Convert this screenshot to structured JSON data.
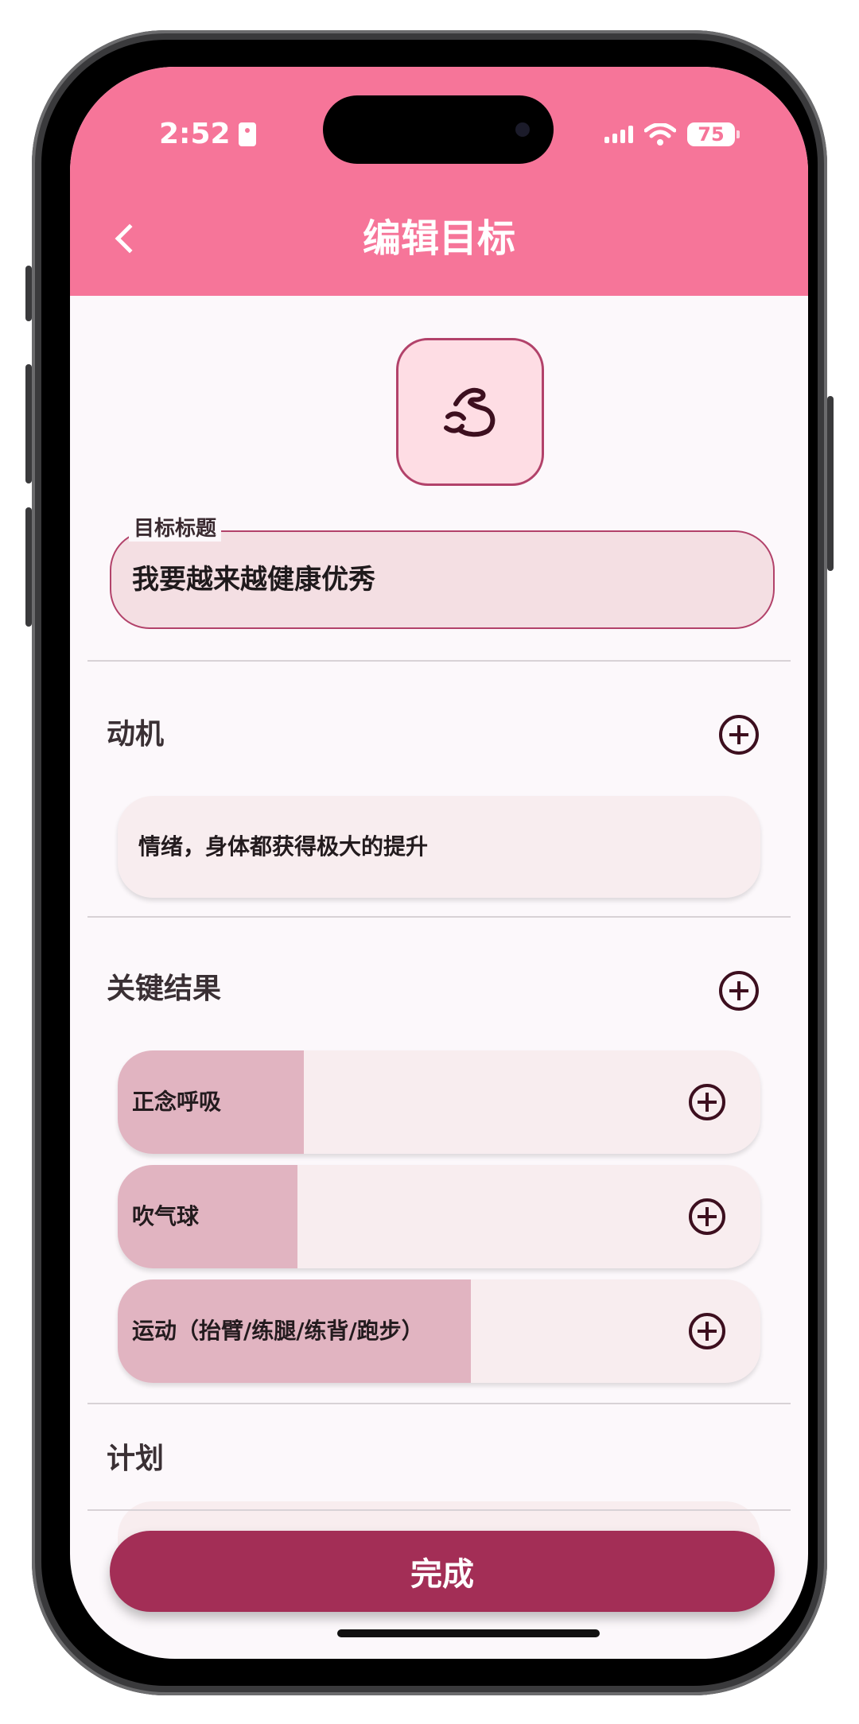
{
  "status_bar": {
    "time": "2:52",
    "battery": "75"
  },
  "header": {
    "title": "编辑目标"
  },
  "goal": {
    "icon": "flexed-bicep-icon",
    "title_label": "目标标题",
    "title_value": "我要越来越健康优秀"
  },
  "motivation": {
    "section_title": "动机",
    "items": [
      "情绪，身体都获得极大的提升"
    ]
  },
  "key_results": {
    "section_title": "关键结果",
    "items": [
      {
        "label": "正念呼吸",
        "progress_percent": 29
      },
      {
        "label": "吹气球",
        "progress_percent": 28
      },
      {
        "label": "运动（抬臂/练腿/练背/跑步）",
        "progress_percent": 55
      }
    ]
  },
  "plan": {
    "section_title": "计划"
  },
  "footer": {
    "done_label": "完成"
  },
  "colors": {
    "header": "#f67599",
    "primary_button": "#a32e56",
    "progress_fill": "#e1b4c1",
    "card_bg": "#f8edef",
    "field_border": "#b2426a"
  }
}
